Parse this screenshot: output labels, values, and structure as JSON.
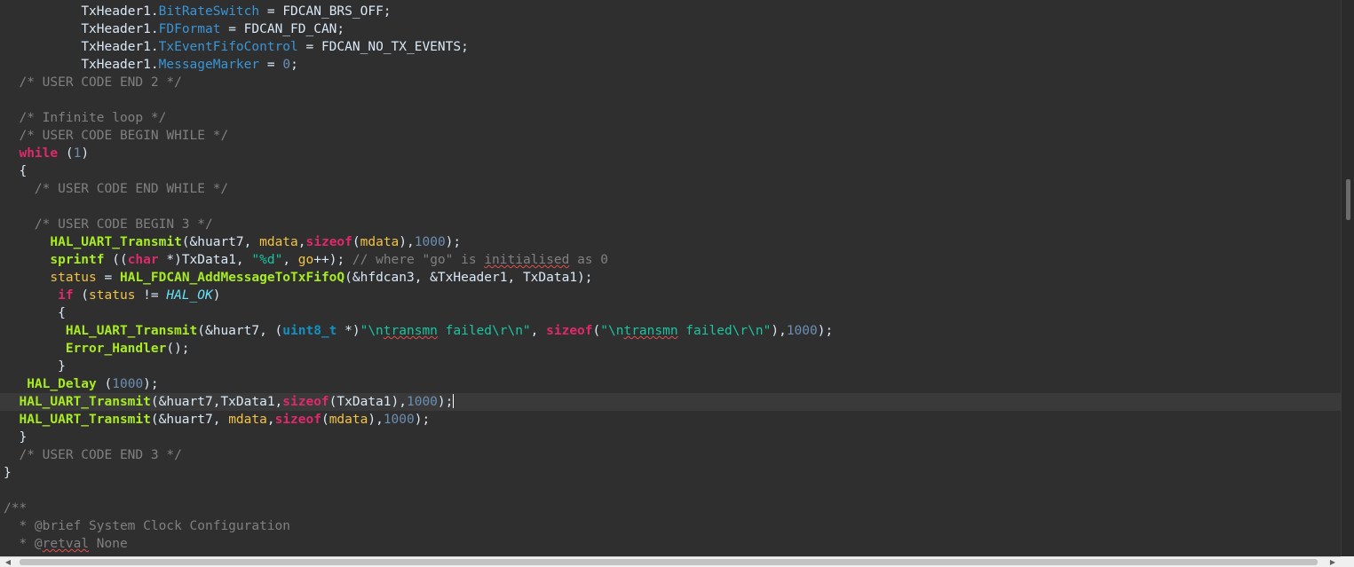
{
  "editor": {
    "lines": [
      {
        "indent": "          ",
        "tokens": [
          {
            "t": "TxHeader1.",
            "c": "plain"
          },
          {
            "t": "BitRateSwitch",
            "c": "field"
          },
          {
            "t": " = FDCAN_BRS_OFF;",
            "c": "plain"
          }
        ]
      },
      {
        "indent": "          ",
        "tokens": [
          {
            "t": "TxHeader1.",
            "c": "plain"
          },
          {
            "t": "FDFormat",
            "c": "field"
          },
          {
            "t": " = FDCAN_FD_CAN;",
            "c": "plain"
          }
        ]
      },
      {
        "indent": "          ",
        "tokens": [
          {
            "t": "TxHeader1.",
            "c": "plain"
          },
          {
            "t": "TxEventFifoControl",
            "c": "field"
          },
          {
            "t": " = FDCAN_NO_TX_EVENTS;",
            "c": "plain"
          }
        ]
      },
      {
        "indent": "          ",
        "tokens": [
          {
            "t": "TxHeader1.",
            "c": "plain"
          },
          {
            "t": "MessageMarker",
            "c": "field"
          },
          {
            "t": " = ",
            "c": "plain"
          },
          {
            "t": "0",
            "c": "num"
          },
          {
            "t": ";",
            "c": "plain"
          }
        ]
      },
      {
        "indent": "  ",
        "tokens": [
          {
            "t": "/* USER CODE END 2 */",
            "c": "comment"
          }
        ]
      },
      {
        "indent": "",
        "tokens": []
      },
      {
        "indent": "  ",
        "tokens": [
          {
            "t": "/* Infinite loop */",
            "c": "comment"
          }
        ]
      },
      {
        "indent": "  ",
        "tokens": [
          {
            "t": "/* USER CODE BEGIN WHILE */",
            "c": "comment"
          }
        ]
      },
      {
        "indent": "  ",
        "tokens": [
          {
            "t": "while",
            "c": "kw"
          },
          {
            "t": " (",
            "c": "plain"
          },
          {
            "t": "1",
            "c": "num"
          },
          {
            "t": ")",
            "c": "plain"
          }
        ]
      },
      {
        "indent": "  ",
        "tokens": [
          {
            "t": "{",
            "c": "plain"
          }
        ]
      },
      {
        "indent": "    ",
        "tokens": [
          {
            "t": "/* USER CODE END WHILE */",
            "c": "comment"
          }
        ]
      },
      {
        "indent": "",
        "tokens": []
      },
      {
        "indent": "    ",
        "tokens": [
          {
            "t": "/* USER CODE BEGIN 3 */",
            "c": "comment"
          }
        ]
      },
      {
        "indent": "      ",
        "tokens": [
          {
            "t": "HAL_UART_Transmit",
            "c": "fn"
          },
          {
            "t": "(&huart7, ",
            "c": "plain"
          },
          {
            "t": "mdata",
            "c": "var"
          },
          {
            "t": ",",
            "c": "plain"
          },
          {
            "t": "sizeof",
            "c": "kw"
          },
          {
            "t": "(",
            "c": "plain"
          },
          {
            "t": "mdata",
            "c": "var"
          },
          {
            "t": "),",
            "c": "plain"
          },
          {
            "t": "1000",
            "c": "num"
          },
          {
            "t": ");",
            "c": "plain"
          }
        ]
      },
      {
        "indent": "      ",
        "tokens": [
          {
            "t": "sprintf",
            "c": "fn"
          },
          {
            "t": " ((",
            "c": "plain"
          },
          {
            "t": "char",
            "c": "kw"
          },
          {
            "t": " *)TxData1, ",
            "c": "plain"
          },
          {
            "t": "\"%d\"",
            "c": "str"
          },
          {
            "t": ", ",
            "c": "plain"
          },
          {
            "t": "go",
            "c": "var"
          },
          {
            "t": "++); ",
            "c": "plain"
          },
          {
            "t": "// where \"go\" is ",
            "c": "comment"
          },
          {
            "t": "initialised",
            "c": "comment",
            "squig": true
          },
          {
            "t": " as 0",
            "c": "comment"
          }
        ]
      },
      {
        "indent": "      ",
        "tokens": [
          {
            "t": "status",
            "c": "var"
          },
          {
            "t": " = ",
            "c": "plain"
          },
          {
            "t": "HAL_FDCAN_AddMessageToTxFifoQ",
            "c": "fn"
          },
          {
            "t": "(&hfdcan3, &TxHeader1, TxData1);",
            "c": "plain"
          }
        ]
      },
      {
        "indent": "       ",
        "tokens": [
          {
            "t": "if",
            "c": "kw"
          },
          {
            "t": " (",
            "c": "plain"
          },
          {
            "t": "status",
            "c": "var"
          },
          {
            "t": " != ",
            "c": "plain"
          },
          {
            "t": "HAL_OK",
            "c": "enum"
          },
          {
            "t": ")",
            "c": "plain"
          }
        ]
      },
      {
        "indent": "       ",
        "tokens": [
          {
            "t": "{",
            "c": "plain"
          }
        ]
      },
      {
        "indent": "        ",
        "tokens": [
          {
            "t": "HAL_UART_Transmit",
            "c": "fn"
          },
          {
            "t": "(&huart7, (",
            "c": "plain"
          },
          {
            "t": "uint8_t",
            "c": "type"
          },
          {
            "t": " *)",
            "c": "plain"
          },
          {
            "t": "\"\\n",
            "c": "str"
          },
          {
            "t": "transmn",
            "c": "str",
            "squig": true
          },
          {
            "t": " failed\\r\\n\"",
            "c": "str"
          },
          {
            "t": ", ",
            "c": "plain"
          },
          {
            "t": "sizeof",
            "c": "kw"
          },
          {
            "t": "(",
            "c": "plain"
          },
          {
            "t": "\"\\n",
            "c": "str"
          },
          {
            "t": "transmn",
            "c": "str",
            "squig": true
          },
          {
            "t": " failed\\r\\n\"",
            "c": "str"
          },
          {
            "t": "),",
            "c": "plain"
          },
          {
            "t": "1000",
            "c": "num"
          },
          {
            "t": ");",
            "c": "plain"
          }
        ]
      },
      {
        "indent": "        ",
        "tokens": [
          {
            "t": "Error_Handler",
            "c": "fn"
          },
          {
            "t": "();",
            "c": "plain"
          }
        ]
      },
      {
        "indent": "       ",
        "tokens": [
          {
            "t": "}",
            "c": "plain"
          }
        ]
      },
      {
        "indent": "   ",
        "tokens": [
          {
            "t": "HAL_Delay",
            "c": "fn"
          },
          {
            "t": " (",
            "c": "plain"
          },
          {
            "t": "1000",
            "c": "num"
          },
          {
            "t": ");",
            "c": "plain"
          }
        ]
      },
      {
        "indent": "  ",
        "current": true,
        "caret": true,
        "tokens": [
          {
            "t": "HAL_UART_Transmit",
            "c": "fn"
          },
          {
            "t": "(&huart7,TxData1,",
            "c": "plain"
          },
          {
            "t": "sizeof",
            "c": "kw"
          },
          {
            "t": "(TxData1),",
            "c": "plain"
          },
          {
            "t": "1000",
            "c": "num"
          },
          {
            "t": ");",
            "c": "plain"
          }
        ]
      },
      {
        "indent": "  ",
        "tokens": [
          {
            "t": "HAL_UART_Transmit",
            "c": "fn"
          },
          {
            "t": "(&huart7, ",
            "c": "plain"
          },
          {
            "t": "mdata",
            "c": "var"
          },
          {
            "t": ",",
            "c": "plain"
          },
          {
            "t": "sizeof",
            "c": "kw"
          },
          {
            "t": "(",
            "c": "plain"
          },
          {
            "t": "mdata",
            "c": "var"
          },
          {
            "t": "),",
            "c": "plain"
          },
          {
            "t": "1000",
            "c": "num"
          },
          {
            "t": ");",
            "c": "plain"
          }
        ]
      },
      {
        "indent": "  ",
        "tokens": [
          {
            "t": "}",
            "c": "plain"
          }
        ]
      },
      {
        "indent": "  ",
        "tokens": [
          {
            "t": "/* USER CODE END 3 */",
            "c": "comment"
          }
        ]
      },
      {
        "indent": "",
        "tokens": [
          {
            "t": "}",
            "c": "plain"
          }
        ]
      },
      {
        "indent": "",
        "tokens": []
      },
      {
        "indent": "",
        "tokens": [
          {
            "t": "/**",
            "c": "comment"
          }
        ]
      },
      {
        "indent": "  ",
        "tokens": [
          {
            "t": "* @brief System Clock Configuration",
            "c": "comment"
          }
        ]
      },
      {
        "indent": "  ",
        "tokens": [
          {
            "t": "* @",
            "c": "comment"
          },
          {
            "t": "retval",
            "c": "comment",
            "squig": true
          },
          {
            "t": " None",
            "c": "comment"
          }
        ]
      }
    ]
  },
  "scrollbars": {
    "horizontal": {
      "left_icon": "scroll-left-arrow-icon",
      "right_icon": "scroll-right-arrow-icon"
    },
    "vertical": {
      "thumb": "vertical-scroll-thumb"
    }
  }
}
